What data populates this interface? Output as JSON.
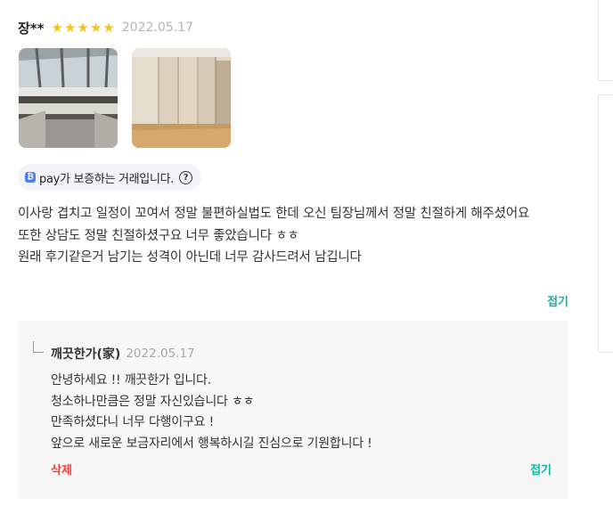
{
  "review": {
    "author": "장**",
    "rating": 5,
    "stars": [
      "★",
      "★",
      "★",
      "★",
      "★"
    ],
    "date": "2022.05.17",
    "photos": [
      "window-frame-photo",
      "wardrobe-closet-photo"
    ],
    "pay_badge": {
      "icon_text": "₿",
      "text": "pay가 보증하는 거래입니다.",
      "help_icon": "?"
    },
    "body_lines": [
      "이사랑 겹치고 일정이 꼬여서 정말 불편하실법도 한데 오신 팀장님께서 정말 친절하게 해주셨어요",
      "또한 상담도 정말 친절하셨구요 너무 좋았습니다 ㅎㅎ",
      "원래 후기같은거 남기는 성격이 아닌데 너무 감사드려서 남깁니다"
    ],
    "fold_label": "접기"
  },
  "reply": {
    "author": "깨끗한가(家)",
    "date": "2022.05.17",
    "lines": [
      "안녕하세요 !! 깨끗한가 입니다.",
      "청소하나만큼은 정말 자신있습니다 ㅎㅎ",
      "만족하셨다니 너무 다행이구요 !",
      "앞으로 새로운 보금자리에서 행복하시길 진심으로 기원합니다 !"
    ],
    "delete_label": "삭제",
    "fold_label": "접기"
  },
  "colors": {
    "star": "#f5c518",
    "accent": "#14b1a3",
    "delete": "#e8463c",
    "pay": "#4f7ef7"
  }
}
